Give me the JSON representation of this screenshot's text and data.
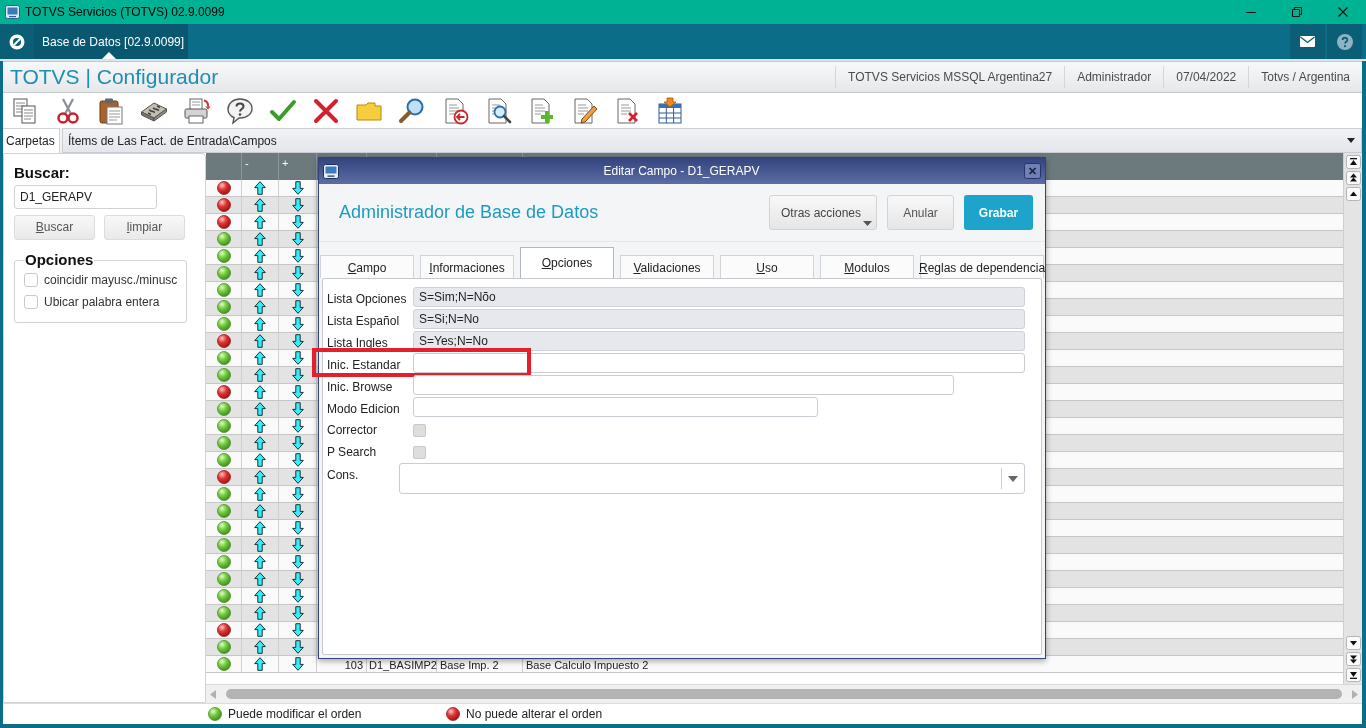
{
  "window": {
    "title": "TOTVS Servicios (TOTVS) 02.9.0099"
  },
  "tabs": [
    {
      "label": "Base de Datos [02.9.0099]",
      "selected": true
    }
  ],
  "header": {
    "app_title": "TOTVS | Configurador",
    "info": [
      "TOTVS Servicios MSSQL Argentina27",
      "Administrador",
      "07/04/2022",
      "Totvs / Argentina"
    ]
  },
  "folder_bar": {
    "label": "Carpetas",
    "path": "Ítems de Las Fact. de Entrada\\Campos"
  },
  "search_panel": {
    "title": "Buscar:",
    "query": "D1_GERAPV",
    "buttons": [
      "Buscar",
      "limpiar"
    ],
    "options_title": "Opciones",
    "options": [
      {
        "label": "coincidir mayusc./minusc",
        "checked": false
      },
      {
        "label": "Ubicar palabra entera",
        "checked": false
      }
    ]
  },
  "grid": {
    "column_headers": [
      "-",
      "+"
    ],
    "rows": [
      {
        "movable": false
      },
      {
        "movable": false
      },
      {
        "movable": false
      },
      {
        "movable": true
      },
      {
        "movable": true
      },
      {
        "movable": true
      },
      {
        "movable": true
      },
      {
        "movable": true
      },
      {
        "movable": true
      },
      {
        "movable": false
      },
      {
        "movable": true
      },
      {
        "movable": true
      },
      {
        "movable": false
      },
      {
        "movable": true
      },
      {
        "movable": true
      },
      {
        "movable": true
      },
      {
        "movable": true
      },
      {
        "movable": false
      },
      {
        "movable": true
      },
      {
        "movable": true
      },
      {
        "movable": true
      },
      {
        "movable": true
      },
      {
        "movable": true
      },
      {
        "movable": true
      },
      {
        "movable": true
      },
      {
        "movable": true
      },
      {
        "movable": false
      },
      {
        "movable": true
      },
      {
        "movable": true,
        "cells": [
          "103",
          "D1_BASIMP2",
          "Base Imp. 2",
          "Base Calculo Impuesto 2"
        ]
      }
    ]
  },
  "dialog": {
    "title": "Editar Campo - D1_GERAPV",
    "heading": "Administrador de Base de Datos",
    "buttons": [
      {
        "label": "Otras acciones",
        "kind": "menu"
      },
      {
        "label": "Anular",
        "kind": "plain"
      },
      {
        "label": "Grabar",
        "kind": "primary"
      }
    ],
    "tabs": [
      {
        "label": "Campo",
        "selected": false
      },
      {
        "label": "Informaciones",
        "selected": false
      },
      {
        "label": "Opciones",
        "selected": true
      },
      {
        "label": "Validaciones",
        "selected": false
      },
      {
        "label": "Uso",
        "selected": false
      },
      {
        "label": "Modulos",
        "selected": false
      },
      {
        "label": "Reglas de dependencia",
        "selected": false
      }
    ],
    "fields": [
      {
        "kind": "text",
        "label": "Lista Opciones",
        "value": "S=Sim;N=Nõo",
        "readonly": true,
        "highlighted": false
      },
      {
        "kind": "text",
        "label": "Lista Español",
        "value": "S=Si;N=No",
        "readonly": true,
        "highlighted": false
      },
      {
        "kind": "text",
        "label": "Lista Ingles",
        "value": "S=Yes;N=No",
        "readonly": true,
        "highlighted": false
      },
      {
        "kind": "text",
        "label": "Inic. Estandar",
        "readonly": false,
        "highlighted": true
      },
      {
        "kind": "text",
        "label": "Inic. Browse",
        "readonly": false,
        "highlighted": false
      },
      {
        "kind": "text",
        "label": "Modo Edicion",
        "readonly": false,
        "highlighted": false
      },
      {
        "kind": "checkbox",
        "label": "Corrector",
        "checked": false,
        "disabled": true,
        "highlighted": false
      },
      {
        "kind": "checkbox",
        "label": "P Search",
        "checked": false,
        "disabled": true,
        "highlighted": false
      },
      {
        "kind": "combo",
        "label": "Cons.",
        "highlighted": false
      }
    ]
  },
  "legend": [
    {
      "movable": true,
      "label": "Puede modificar el orden"
    },
    {
      "movable": false,
      "label": "No puede alterar el orden"
    }
  ]
}
